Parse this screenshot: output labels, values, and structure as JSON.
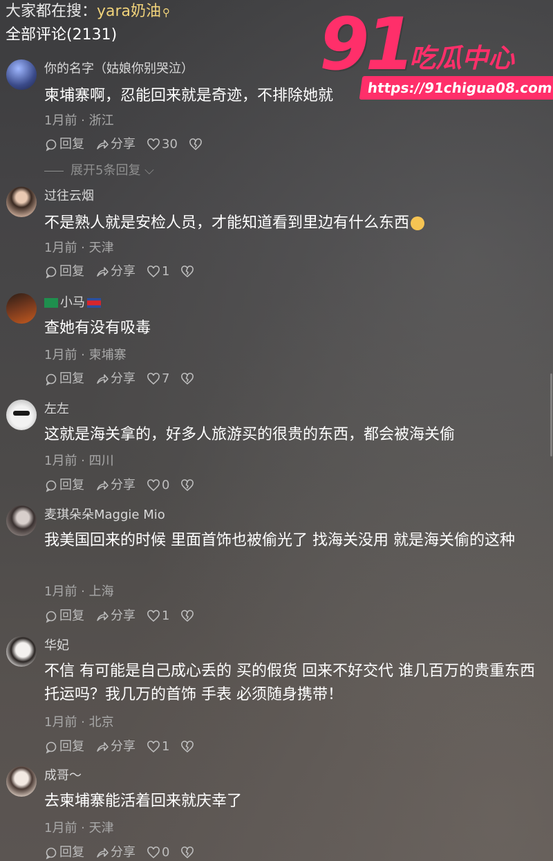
{
  "header": {
    "search_prefix": "大家都在搜：",
    "search_keyword": "yara奶油",
    "comment_count": "全部评论(2131)"
  },
  "watermark": {
    "big_text": "91",
    "name": "吃瓜中心",
    "url": "https://91chigua08.com"
  },
  "actions": {
    "reply": "回复",
    "share": "分享"
  },
  "comments": [
    {
      "username": "你的名字（姑娘你别哭泣）",
      "text": "柬埔寨啊，忍能回来就是奇迹，不排除她就",
      "meta": "1月前 · 浙江",
      "likes": "30",
      "expand": "展开5条回复",
      "avatar_color": "#3b4b8a"
    },
    {
      "username": "过往云烟",
      "text": "不是熟人就是安检人员，才能知道看到里边有什么东西",
      "meta": "1月前 · 天津",
      "likes": "1",
      "avatar_color": "#8c6b5a"
    },
    {
      "username": "小马",
      "text": "查她有没有吸毒",
      "meta": "1月前 · 柬埔寨",
      "likes": "7",
      "avatar_color": "#7a3a1e"
    },
    {
      "username": "左左",
      "text": "这就是海关拿的，好多人旅游买的很贵的东西，都会被海关偷",
      "meta": "1月前 · 四川",
      "likes": "0",
      "avatar_color": "#d9d9d9"
    },
    {
      "username": "麦琪朵朵Maggie Mio",
      "text": "我美国回来的时候 里面首饰也被偷光了 找海关没用 就是海关偷的这种",
      "meta": "1月前 · 上海",
      "likes": "1",
      "avatar_color": "#6d6562"
    },
    {
      "username": "华妃",
      "text": "不信 有可能是自己成心丢的 买的假货 回来不好交代 谁几百万的贵重东西托运吗？我几万的首饰 手表 必须随身携带！",
      "meta": "1月前 · 北京",
      "likes": "1",
      "avatar_color": "#e6e6e6"
    },
    {
      "username": "成哥～",
      "text": "去柬埔寨能活着回来就庆幸了",
      "meta": "1月前 · 天津",
      "likes": "0",
      "avatar_color": "#d8c9be"
    }
  ]
}
